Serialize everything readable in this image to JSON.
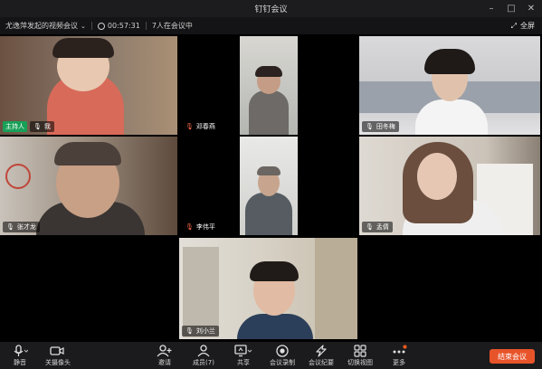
{
  "window": {
    "title": "钉钉会议"
  },
  "infobar": {
    "meeting_name": "尤逸萍发起的视频会议",
    "duration": "00:57:31",
    "participants_in_meeting": "7人在会议中",
    "fullscreen_label": "全屏"
  },
  "tiles": [
    {
      "name": "我",
      "host_label": "主持人"
    },
    {
      "name": "邓春燕"
    },
    {
      "name": "田冬梅"
    },
    {
      "name": "张才龙"
    },
    {
      "name": "李伟平"
    },
    {
      "name": "孟倩"
    },
    {
      "name": "刘小兰"
    }
  ],
  "toolbar": {
    "mute": "静音",
    "camera_off": "关摄像头",
    "invite": "邀请",
    "members": "成员(7)",
    "share": "共享",
    "record": "会议录制",
    "minutes": "会议纪要",
    "switch_view": "切换视图",
    "more": "更多",
    "end_meeting": "结束会议"
  },
  "colors": {
    "host_badge": "#18a058",
    "end_button": "#e8542a",
    "more_dot": "#ff5a1f"
  }
}
